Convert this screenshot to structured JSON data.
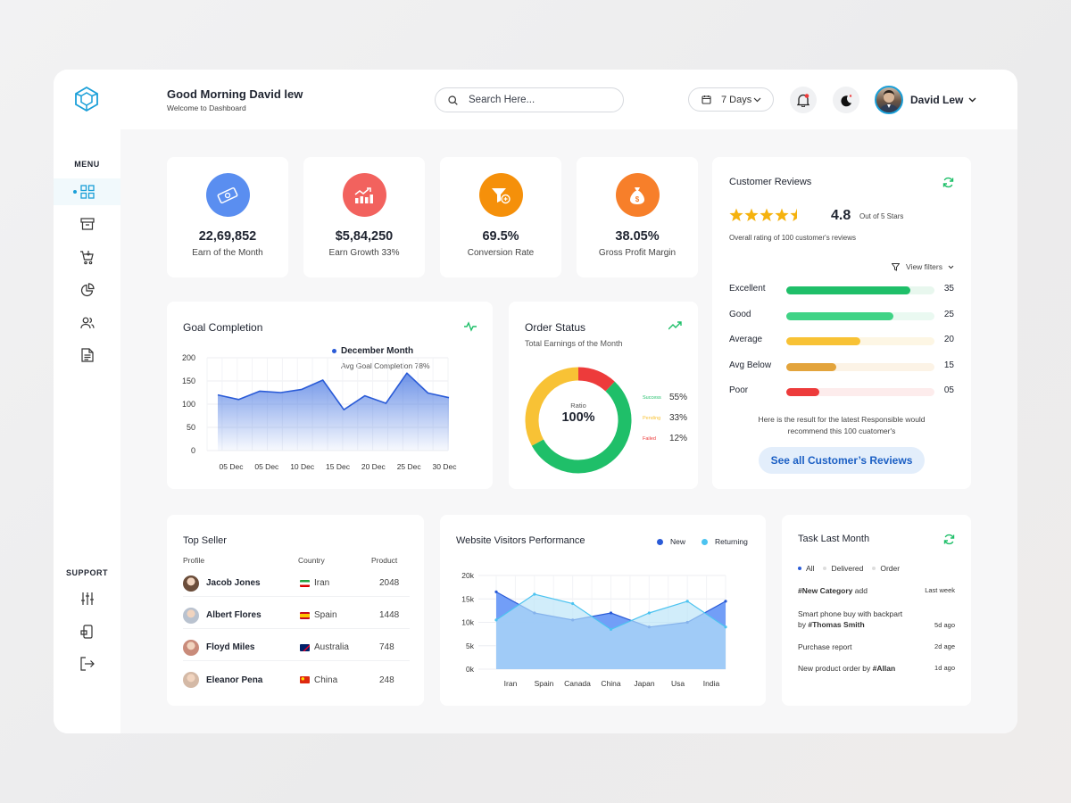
{
  "header": {
    "greeting": "Good Morning David lew",
    "subtitle": "Welcome to Dashboard",
    "search_placeholder": "Search Here...",
    "date_range": "7 Days",
    "user_name": "David Lew"
  },
  "sidebar": {
    "menu_label": "MENU",
    "support_label": "SUPPORT",
    "menu_items": [
      "dashboard-icon",
      "archive-icon",
      "cart-icon",
      "chart-pie-icon",
      "users-icon",
      "document-icon"
    ],
    "support_items": [
      "sliders-icon",
      "device-icon",
      "logout-icon"
    ]
  },
  "stats": [
    {
      "value": "22,69,852",
      "label": "Earn of the Month",
      "color": "#5a8ef0",
      "icon": "money-icon"
    },
    {
      "value": "$5,84,250",
      "label": "Earn Growth 33%",
      "color": "#f2625e",
      "icon": "growth-icon"
    },
    {
      "value": "69.5%",
      "label": "Conversion Rate",
      "color": "#f5900a",
      "icon": "funnel-icon"
    },
    {
      "value": "38.05%",
      "label": "Gross Profit Margin",
      "color": "#f77f2a",
      "icon": "money-bag-icon"
    }
  ],
  "goal": {
    "title": "Goal Completion",
    "tooltip_title": "December Month",
    "tooltip_sub": "Avg Goal Completion 78%"
  },
  "order": {
    "title": "Order Status",
    "subtitle": "Total Earnings of the Month",
    "center_label": "Ratio",
    "center_value": "100%",
    "legend": [
      {
        "name": "Success",
        "value": "55%",
        "color": "#1fbf69"
      },
      {
        "name": "Pending",
        "value": "33%",
        "color": "#f8c235"
      },
      {
        "name": "Failed",
        "value": "12%",
        "color": "#ed3b3b"
      }
    ]
  },
  "reviews": {
    "title": "Customer Reviews",
    "rating": "4.8",
    "rating_suffix": "Out of 5 Stars",
    "stars": 4.5,
    "overall": "Overall rating of 100 customer's reviews",
    "filters_label": "View filters",
    "rows": [
      {
        "name": "Excellent",
        "count": "35",
        "level": 0.84,
        "color": "#1fbf69",
        "track": "#e8f7ee"
      },
      {
        "name": "Good",
        "count": "25",
        "level": 0.72,
        "color": "#40d386",
        "track": "#eaf9f1"
      },
      {
        "name": "Average",
        "count": "20",
        "level": 0.5,
        "color": "#f8c235",
        "track": "#fdf6e4"
      },
      {
        "name": "Avg Below",
        "count": "15",
        "level": 0.34,
        "color": "#e3a43c",
        "track": "#fcf3e6"
      },
      {
        "name": "Poor",
        "count": "05",
        "level": 0.22,
        "color": "#ed3b3b",
        "track": "#fdecec"
      }
    ],
    "note_line1": "Here is the result for the latest Responsible would",
    "note_line2": "recommend this 100 cuatomer's",
    "cta": "See all Customer’s Reviews"
  },
  "sellers": {
    "title": "Top Seller",
    "columns": [
      "Profile",
      "Country",
      "Product"
    ],
    "rows": [
      {
        "name": "Jacob Jones",
        "country": "Iran",
        "product": "2048"
      },
      {
        "name": "Albert Flores",
        "country": "Spain",
        "product": "1448"
      },
      {
        "name": "Floyd Miles",
        "country": "Australia",
        "product": "748"
      },
      {
        "name": "Eleanor Pena",
        "country": "China",
        "product": "248"
      }
    ]
  },
  "visitors": {
    "title": "Website Visitors Performance",
    "legend_new": "New",
    "legend_returning": "Returning"
  },
  "tasks": {
    "title": "Task Last Month",
    "filters": [
      "All",
      "Delivered",
      "Order"
    ],
    "items": [
      {
        "line1_bold": "#New Category",
        "line1_rest": " add",
        "line2_pre": "",
        "line2_bold": "",
        "when": "Last week"
      },
      {
        "line1_bold": "",
        "line1_rest": "Smart phone buy with backpart",
        "line2_pre": "by ",
        "line2_bold": "#Thomas Smith",
        "when": "5d ago"
      },
      {
        "line1_bold": "",
        "line1_rest": "Purchase report",
        "line2_pre": "",
        "line2_bold": "",
        "when": "2d age"
      },
      {
        "line1_bold": "#Allan",
        "line1_rest": "New product order by ",
        "line2_pre": "",
        "line2_bold": "",
        "when": "1d ago"
      }
    ]
  },
  "chart_data": [
    {
      "type": "area",
      "title": "Goal Completion",
      "x": [
        "05 Dec",
        "05 Dec",
        "10 Dec",
        "15 Dec",
        "20 Dec",
        "25 Dec",
        "30 Dec"
      ],
      "series": [
        {
          "values": [
            120,
            110,
            128,
            125,
            132,
            152,
            88,
            118,
            102,
            167,
            124,
            114
          ]
        }
      ],
      "ylim": [
        0,
        200
      ],
      "yticks": [
        "200",
        "150",
        "100",
        "50",
        "0"
      ],
      "grid": true
    },
    {
      "type": "pie",
      "title": "Order Status",
      "categories": [
        "Success",
        "Pending",
        "Failed"
      ],
      "values": [
        55,
        33,
        12
      ]
    },
    {
      "type": "area",
      "title": "Website Visitors Performance",
      "categories": [
        "Iran",
        "Spain",
        "Canada",
        "China",
        "Japan",
        "Usa",
        "India"
      ],
      "series": [
        {
          "name": "New",
          "values": [
            16500,
            12000,
            10500,
            12000,
            9000,
            10000,
            14500
          ]
        },
        {
          "name": "Returning",
          "values": [
            10500,
            16000,
            14000,
            8500,
            12000,
            14500,
            9000
          ]
        }
      ],
      "ylim": [
        0,
        20000
      ],
      "yticks": [
        "20k",
        "15k",
        "10k",
        "5k",
        "0k"
      ],
      "grid": true
    }
  ]
}
